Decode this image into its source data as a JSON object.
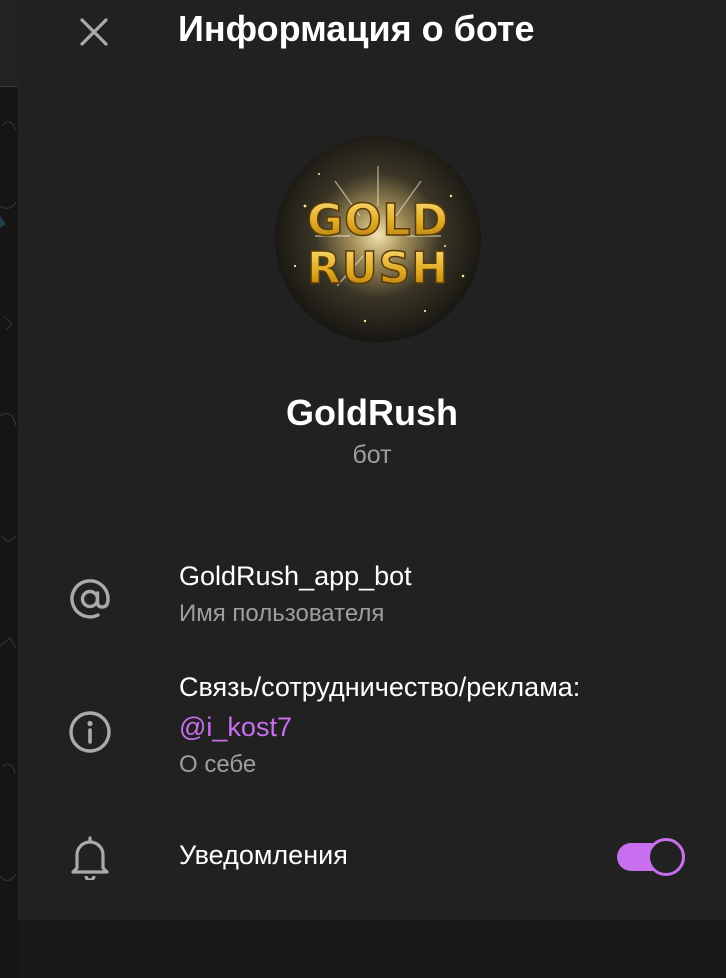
{
  "header": {
    "title": "Информация о боте",
    "close_icon": "close-icon"
  },
  "bot": {
    "name": "GoldRush",
    "type": "бот",
    "avatar_text": [
      "GOLD",
      "RUSH"
    ]
  },
  "username": {
    "value": "GoldRush_app_bot",
    "label": "Имя пользователя",
    "icon": "at-icon"
  },
  "about": {
    "text": "Связь/сотрудничество/реклама:",
    "link": "@i_kost7",
    "label": "О себе",
    "icon": "info-icon"
  },
  "notifications": {
    "label": "Уведомления",
    "enabled": true,
    "icon": "bell-icon"
  },
  "colors": {
    "accent": "#c86ff0",
    "background": "#212121",
    "secondary_text": "#9e9e9e"
  }
}
